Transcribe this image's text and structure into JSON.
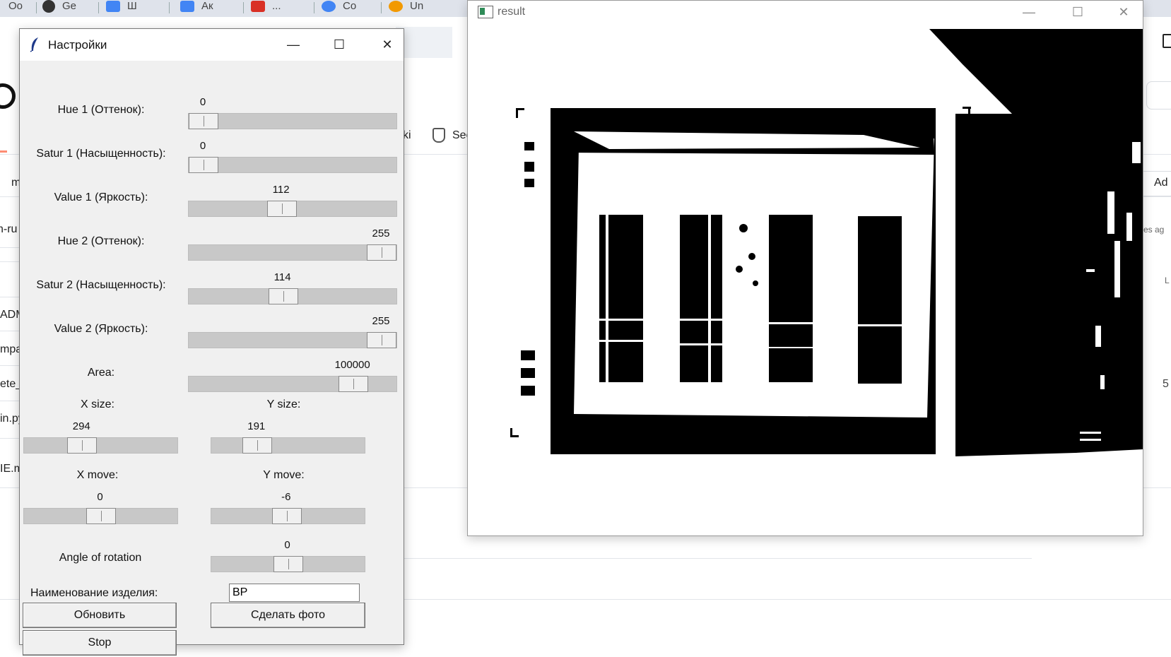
{
  "browser": {
    "tabs": [
      {
        "label": "Oo",
        "color": "#888888"
      },
      {
        "label": "Ge",
        "color": "#333333"
      },
      {
        "label": "Ш",
        "color": "#4285f4"
      },
      {
        "label": "Ак",
        "color": "#4285f4"
      },
      {
        "label": "...",
        "color": "#d93025"
      },
      {
        "label": "Co",
        "color": "#4285f4"
      },
      {
        "label": "Un",
        "color": "#f29900"
      }
    ],
    "fragments": {
      "ki": "ki",
      "security": "Sec",
      "ad": "Ad",
      "m": "m",
      "rus": "n-ru",
      "adm": "ADM",
      "mpa": "mpa",
      "ete": "ete_",
      "inpy": "in.py",
      "iem": "IE.m",
      "es_ag": "es ag",
      "l": "L",
      "five": "5"
    }
  },
  "settings": {
    "title": "Настройки",
    "sliders": [
      {
        "label": "Hue 1 (Оттенок):",
        "value": "0",
        "fraction": 0.0
      },
      {
        "label": "Satur 1 (Насыщенность):",
        "value": "0",
        "fraction": 0.0
      },
      {
        "label": "Value 1 (Яркость):",
        "value": "112",
        "fraction": 0.439
      },
      {
        "label": "Hue 2 (Оттенок):",
        "value": "255",
        "fraction": 1.0
      },
      {
        "label": "Satur 2 (Насыщенность):",
        "value": "114",
        "fraction": 0.447
      },
      {
        "label": "Value 2 (Яркость):",
        "value": "255",
        "fraction": 1.0
      },
      {
        "label": "Area:",
        "value": "100000",
        "fraction": 0.84
      }
    ],
    "x_size": {
      "label": "X size:",
      "value": "294",
      "fraction": 0.35
    },
    "y_size": {
      "label": "Y size:",
      "value": "191",
      "fraction": 0.25
    },
    "x_move": {
      "label": "X move:",
      "value": "0",
      "fraction": 0.5
    },
    "y_move": {
      "label": "Y move:",
      "value": "-6",
      "fraction": 0.49
    },
    "angle": {
      "label": "Angle of rotation",
      "value": "0",
      "fraction": 0.5
    },
    "product_label": "Наименование изделия:",
    "product_value": "BP",
    "buttons": {
      "refresh": "Обновить",
      "photo": "Сделать фото",
      "stop": "Stop"
    }
  },
  "result": {
    "title": "result"
  },
  "icons": {
    "app": "feather-icon",
    "min": "minimize-icon",
    "max": "maximize-icon",
    "close": "close-icon"
  }
}
